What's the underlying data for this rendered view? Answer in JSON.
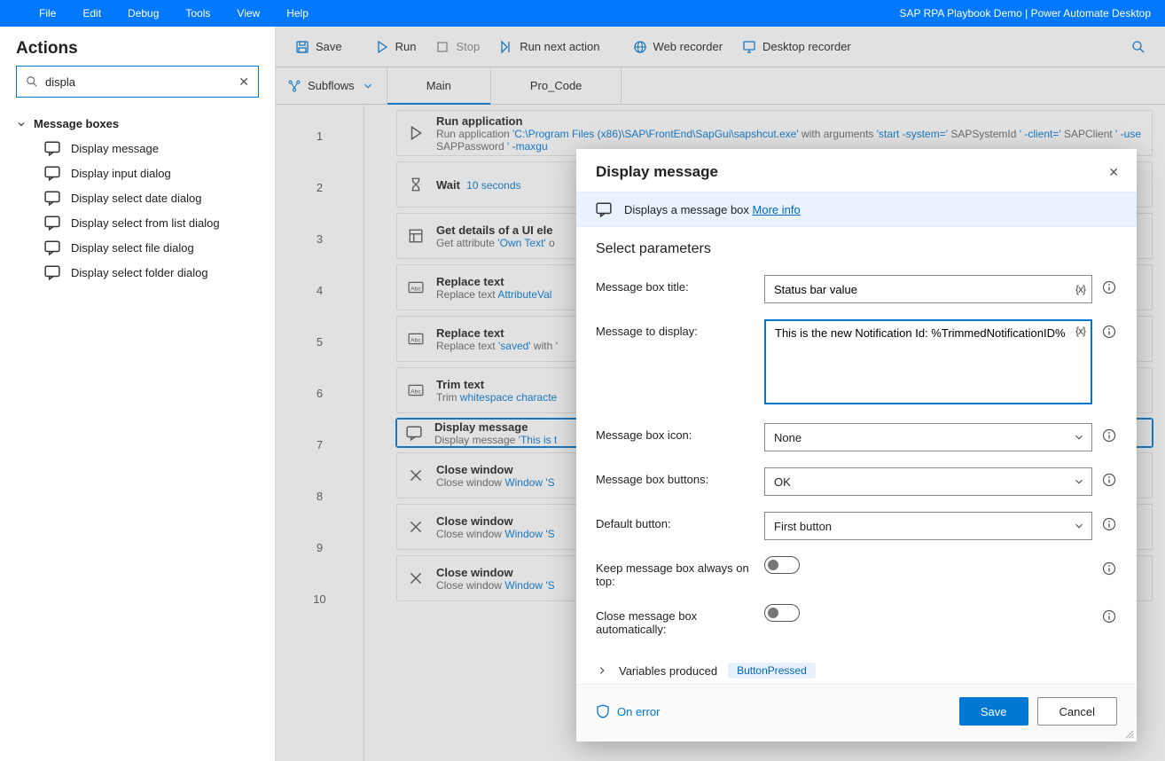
{
  "menubar": {
    "items": [
      "File",
      "Edit",
      "Debug",
      "Tools",
      "View",
      "Help"
    ],
    "title": "SAP RPA Playbook Demo | Power Automate Desktop"
  },
  "left": {
    "header": "Actions",
    "search_value": "displa",
    "category": "Message boxes",
    "items": [
      "Display message",
      "Display input dialog",
      "Display select date dialog",
      "Display select from list dialog",
      "Display select file dialog",
      "Display select folder dialog"
    ]
  },
  "toolbar": {
    "save": "Save",
    "run": "Run",
    "stop": "Stop",
    "runnext": "Run next action",
    "webrec": "Web recorder",
    "deskrec": "Desktop recorder"
  },
  "subflow": {
    "label": "Subflows",
    "tabs": [
      "Main",
      "Pro_Code"
    ]
  },
  "steps": [
    {
      "t1": "Run application",
      "t2a": "Run application ",
      "blue1": "'C:\\Program Files (x86)\\SAP\\FrontEnd\\SapGui\\sapshcut.exe'",
      "t2b": " with arguments ",
      "blue2": "'start -system='",
      "t2c": "  SAPSystemId  ",
      "blue3": "' -client='",
      "t2d": "  SAPClient  ",
      "blue4": "' -use",
      "t2e": "             SAPPassword  ",
      "blue5": "' -maxgu"
    },
    {
      "t1": "Wait",
      "side": "10 seconds"
    },
    {
      "t1": "Get details of a UI ele",
      "t2a": "Get attribute ",
      "blue1": "'Own Text'",
      "t2b": " o"
    },
    {
      "t1": "Replace text",
      "t2a": "Replace text  ",
      "blue1": "AttributeVal"
    },
    {
      "t1": "Replace text",
      "t2a": "Replace text ",
      "blue1": "'saved'",
      "t2b": " with '"
    },
    {
      "t1": "Trim text",
      "t2a": "Trim ",
      "blue1": "whitespace characte"
    },
    {
      "t1": "Display message",
      "t2a": "Display message ",
      "blue1": "'This is t"
    },
    {
      "t1": "Close window",
      "t2a": "Close window ",
      "blue1": "Window 'S"
    },
    {
      "t1": "Close window",
      "t2a": "Close window ",
      "blue1": "Window 'S"
    },
    {
      "t1": "Close window",
      "t2a": "Close window ",
      "blue1": "Window 'S"
    }
  ],
  "dialog": {
    "title": "Display message",
    "info": "Displays a message box",
    "more": "More info",
    "section": "Select parameters",
    "labels": {
      "title": "Message box title:",
      "msg": "Message to display:",
      "icon": "Message box icon:",
      "buttons": "Message box buttons:",
      "defbtn": "Default button:",
      "ontop": "Keep message box always on top:",
      "autoclose": "Close message box automatically:"
    },
    "values": {
      "title": "Status bar value",
      "msg": "This is the new Notification Id: %TrimmedNotificationID%",
      "icon": "None",
      "buttons": "OK",
      "defbtn": "First button"
    },
    "varprod_label": "Variables produced",
    "varprod_chip": "ButtonPressed",
    "onerror": "On error",
    "save": "Save",
    "cancel": "Cancel"
  }
}
